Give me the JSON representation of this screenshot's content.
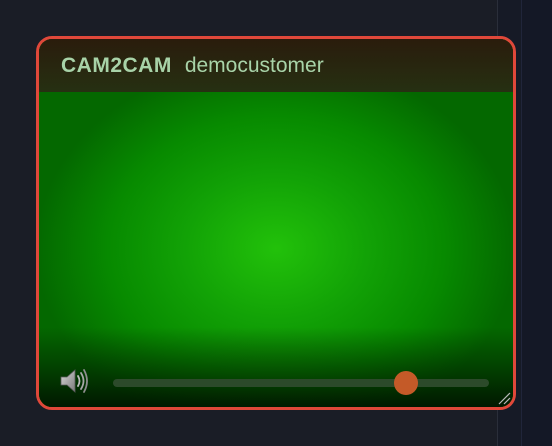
{
  "window": {
    "brand": "CAM2CAM",
    "username": "democustomer"
  },
  "controls": {
    "volume_level": 0.78
  },
  "icons": {
    "speaker": "speaker-icon",
    "resize": "resize-grip-icon"
  },
  "colors": {
    "window_border": "#e0483a",
    "slider_thumb": "#c45a28",
    "title_text": "#a8d3a8",
    "video_green": "#22c10a"
  }
}
